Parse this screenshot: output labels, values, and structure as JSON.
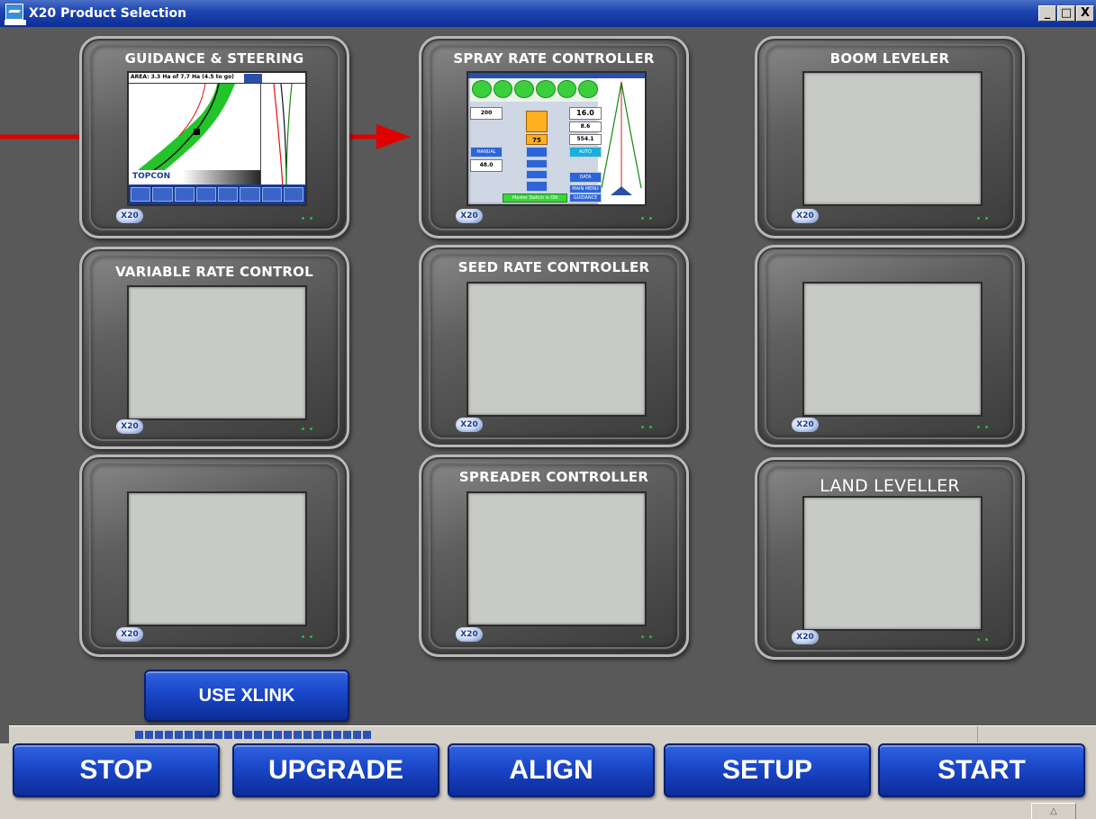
{
  "window": {
    "title": "X20 Product Selection",
    "controls": [
      "_",
      "□",
      "X"
    ]
  },
  "devices": [
    {
      "id": "guidance",
      "title": "GUIDANCE & STEERING",
      "badge": "X20",
      "screen": "guidance"
    },
    {
      "id": "spray",
      "title": "SPRAY RATE CONTROLLER",
      "badge": "X20",
      "screen": "spray"
    },
    {
      "id": "boom",
      "title": "BOOM LEVELER",
      "badge": "X20",
      "screen": "blank"
    },
    {
      "id": "variable",
      "title": "VARIABLE RATE CONTROL",
      "badge": "X20",
      "screen": "blank"
    },
    {
      "id": "seed",
      "title": "SEED RATE CONTROLLER",
      "badge": "X20",
      "screen": "blank"
    },
    {
      "id": "empty1",
      "title": "",
      "badge": "X20",
      "screen": "blank"
    },
    {
      "id": "empty2",
      "title": "",
      "badge": "X20",
      "screen": "blank"
    },
    {
      "id": "spreader",
      "title": "SPREADER CONTROLLER",
      "badge": "X20",
      "screen": "blank"
    },
    {
      "id": "land",
      "title": "LAND LEVELLER",
      "badge": "X20",
      "screen": "blank"
    }
  ],
  "guidance_screen": {
    "area_text": "AREA: 3.3 Ha of 7.7 Ha (4.5 to go)",
    "logo_text": "TOPCON"
  },
  "spray_screen": {
    "rate_target": "200",
    "speed": "16.0",
    "value_b": "8.6",
    "value_c": "554.1",
    "orange_value": "75",
    "manual_label": "MANUAL",
    "auto_label": "AUTO",
    "pressure": "48.0",
    "data_label": "DATA",
    "main_menu_label": "MAIN MENU",
    "guidance_label": "GUIDANCE",
    "master_label": "Master Switch is ON"
  },
  "xlink_button": {
    "label": "USE XLINK"
  },
  "progress": {
    "segments": 24
  },
  "actions": [
    {
      "id": "stop",
      "label": "STOP"
    },
    {
      "id": "upgrade",
      "label": "UPGRADE"
    },
    {
      "id": "align",
      "label": "ALIGN"
    },
    {
      "id": "setup",
      "label": "SETUP"
    },
    {
      "id": "start",
      "label": "START"
    }
  ],
  "colors": {
    "accent_blue": "#1a46c8",
    "arrow_red": "#e00000",
    "background": "#595959",
    "led_green": "#1fbd3c"
  },
  "icons": {
    "app": "x20-app-icon",
    "arrow": "red-pointer-arrow",
    "scroll": "chevron-up-icon"
  }
}
